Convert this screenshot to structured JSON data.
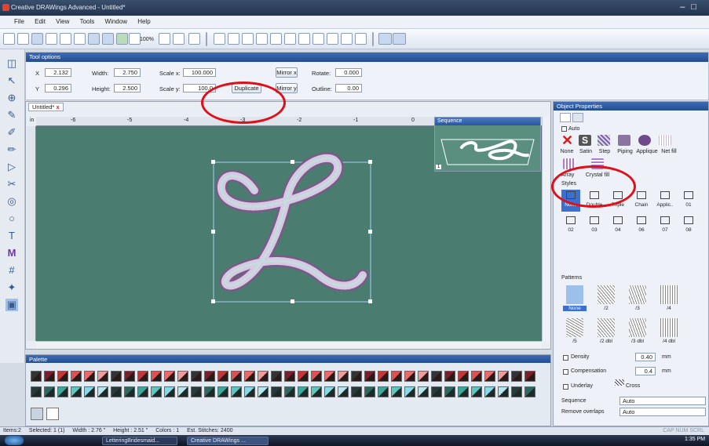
{
  "window": {
    "title": "Creative DRAWings Advanced - Untitled*"
  },
  "menu": [
    "File",
    "Edit",
    "View",
    "Tools",
    "Window",
    "Help"
  ],
  "toolbar": {
    "zoom": "100%"
  },
  "tool_options": {
    "header": "Tool options",
    "x_label": "X",
    "x_value": "2.132",
    "y_label": "Y",
    "y_value": "0.296",
    "width_label": "Width:",
    "width_value": "2.750",
    "height_label": "Height:",
    "height_value": "2.500",
    "scalex_label": "Scale x:",
    "scalex_value": "100.000",
    "scaley_label": "Scale y:",
    "scaley_value": "100.0",
    "duplicate_label": "Duplicate",
    "mirrorx_label": "Mirror x",
    "mirrory_label": "Mirror y",
    "rotate_label": "Rotate:",
    "rotate_value": "0.000",
    "outline_label": "Outline:",
    "outline_value": "0.00"
  },
  "document": {
    "tab": "Untitled*",
    "ruler_unit": "in",
    "ruler_ticks": [
      "-6",
      "-5",
      "-4",
      "-3",
      "-2",
      "-1",
      "0"
    ]
  },
  "sequence": {
    "header": "Sequence",
    "item_number": "1"
  },
  "palette": {
    "header": "Palette"
  },
  "object_properties": {
    "header": "Object Properties",
    "auto_label": "Auto",
    "types": [
      "None",
      "Satin",
      "Step",
      "Piping",
      "Applique",
      "Net fill"
    ],
    "types2": [
      "Array",
      "Crystal fill"
    ],
    "styles_label": "Styles",
    "style_row1": [
      "None",
      "Double",
      "Triple",
      "Chain",
      "Applic..",
      "01"
    ],
    "style_row2": [
      "02",
      "03",
      "04",
      "06",
      "07",
      "08"
    ],
    "patterns_label": "Patterns",
    "pattern_row1": [
      "None",
      "/2",
      "/3",
      "/4"
    ],
    "pattern_row2": [
      "/5",
      "/2 dbl",
      "/3 dbl",
      "/4 dbl"
    ],
    "density_label": "Density",
    "density_value": "0.40",
    "density_unit": "mm",
    "compensation_label": "Compensation",
    "compensation_value": "0.4",
    "compensation_unit": "mm",
    "underlay_label": "Underlay",
    "underlay_value": "Cross",
    "sequence_label": "Sequence",
    "sequence_value": "Auto",
    "remove_overlaps_label": "Remove overlaps",
    "remove_overlaps_value": "Auto"
  },
  "status": {
    "items": "Items:2",
    "selected": "Selected: 1 (1)",
    "width": "Width : 2.76 \"",
    "height": "Height : 2.51 \"",
    "colors": "Colors : 1",
    "stitches": "Est. Stitches: 2400",
    "mode": "CAP NUM SCRL"
  },
  "taskbar": {
    "task1": "LetteringBridesmaid...",
    "task2": "Creative DRAWings ...",
    "clock": "1:35 PM"
  },
  "colors": {
    "canvas": "#4a7d6f",
    "highlight_ring": "#e0101a"
  }
}
